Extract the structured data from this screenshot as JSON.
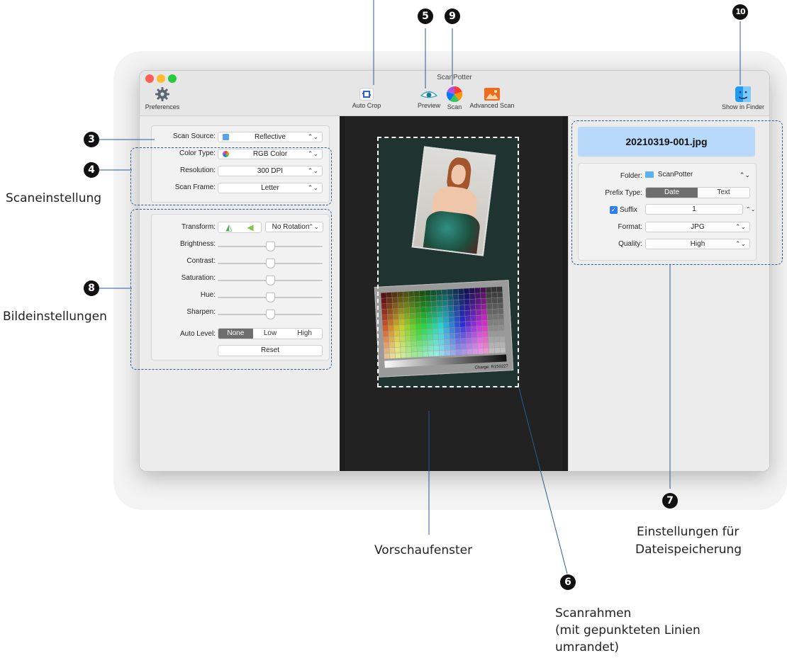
{
  "window": {
    "title": "ScanPotter"
  },
  "toolbar": {
    "preferences": "Preferences",
    "auto_crop": "Auto Crop",
    "preview": "Preview",
    "scan": "Scan",
    "advanced_scan": "Advanced Scan",
    "show_in_finder": "Show in Finder"
  },
  "scan_settings": {
    "scan_source_label": "Scan Source:",
    "scan_source_value": "Reflective",
    "color_type_label": "Color Type:",
    "color_type_value": "RGB Color",
    "resolution_label": "Resolution:",
    "resolution_value": "300 DPI",
    "scan_frame_label": "Scan Frame:",
    "scan_frame_value": "Letter"
  },
  "image_settings": {
    "transform_label": "Transform:",
    "rotation_value": "No Rotation",
    "sliders": [
      {
        "label": "Brightness:",
        "value": 0.5
      },
      {
        "label": "Contrast:",
        "value": 0.5
      },
      {
        "label": "Saturation:",
        "value": 0.5
      },
      {
        "label": "Hue:",
        "value": 0.5
      },
      {
        "label": "Sharpen:",
        "value": 0.5
      }
    ],
    "auto_level_label": "Auto Level:",
    "auto_level_options": [
      "None",
      "Low",
      "High"
    ],
    "auto_level_selected": "None",
    "reset": "Reset"
  },
  "file_settings": {
    "filename": "20210319-001.jpg",
    "folder_label": "Folder:",
    "folder_value": "ScanPotter",
    "prefix_type_label": "Prefix Type:",
    "prefix_options": [
      "Date",
      "Text"
    ],
    "prefix_selected": "Date",
    "suffix_label": "Suffix",
    "suffix_checked": true,
    "suffix_value": "1",
    "format_label": "Format:",
    "format_value": "JPG",
    "quality_label": "Quality:",
    "quality_value": "High"
  },
  "callouts": {
    "n3": "3",
    "n4": "4",
    "n5": "5",
    "n6": "6",
    "n7": "7",
    "n8": "8",
    "n9": "9",
    "n10": "10"
  },
  "captions": {
    "scan_settings": "Scaneinstellung",
    "image_settings": "Bildeinstellungen",
    "preview_window": "Vorschaufenster",
    "file_saving_line1": "Einstellungen für",
    "file_saving_line2": "Dateispeicherung",
    "scan_frame_line1": "Scanrahmen",
    "scan_frame_line2": "(mit gepunkteten Linien",
    "scan_frame_line3": "umrandet)"
  },
  "preview_image": {
    "chart_caption": "Charge: R150227"
  },
  "colors": {
    "accent": "#2a5b98",
    "filename_bg": "#b8d9fa",
    "preview_bg": "#1d1d1d"
  }
}
